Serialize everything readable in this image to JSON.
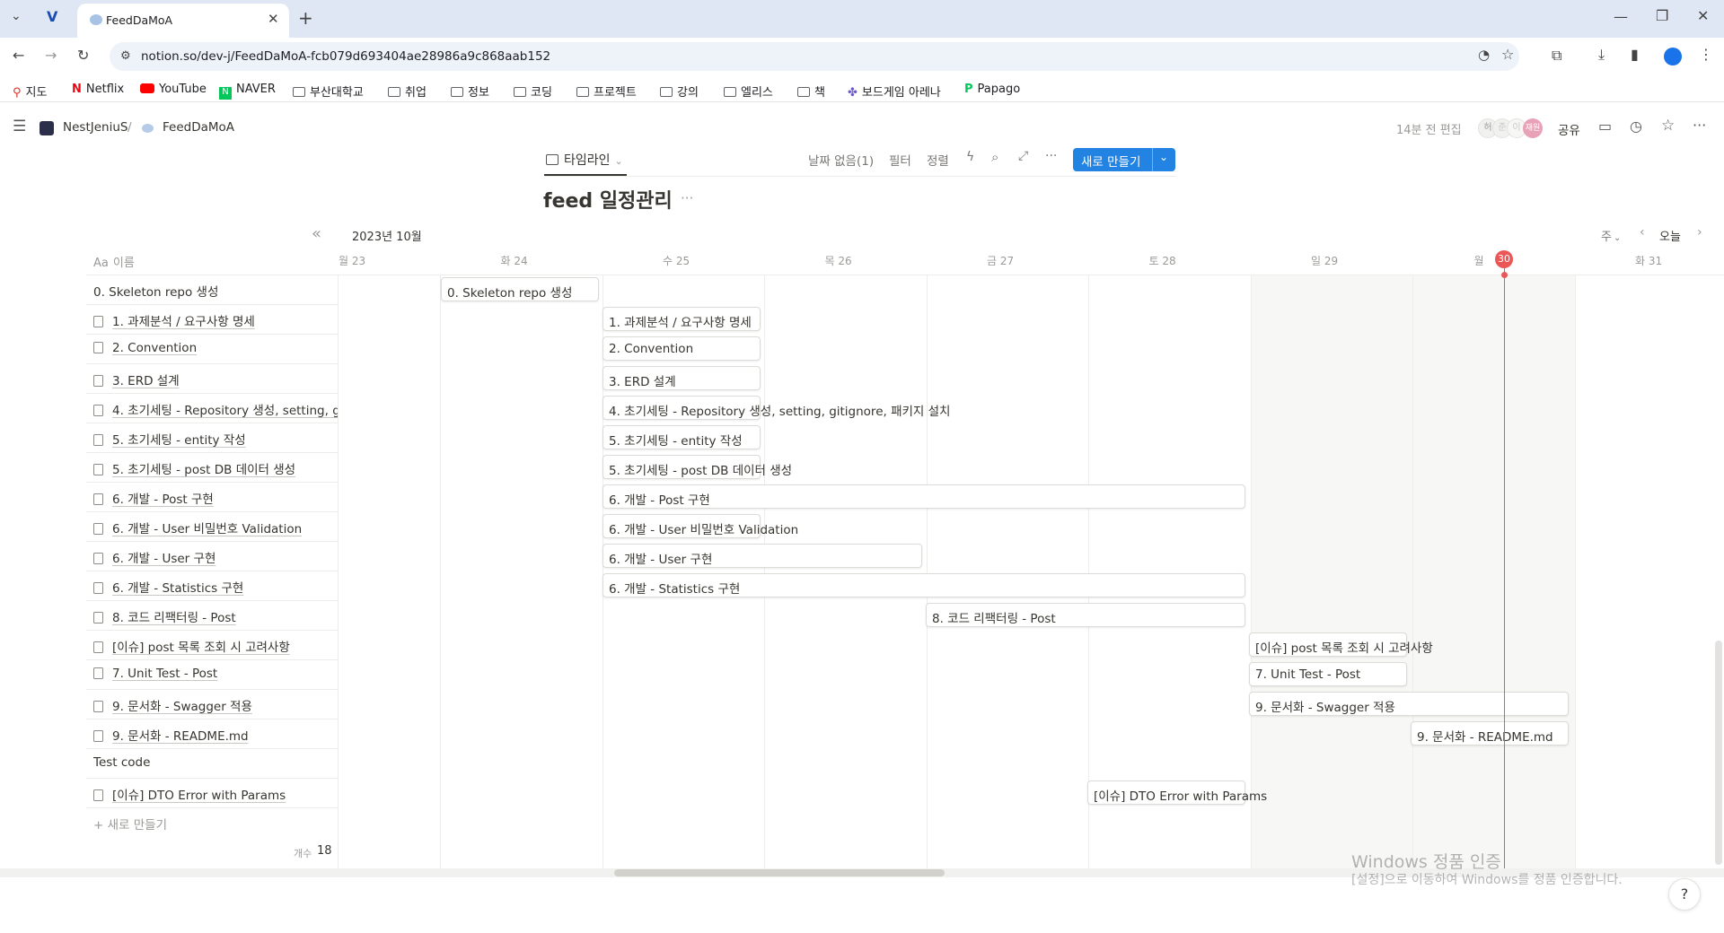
{
  "browser": {
    "tab_title": "FeedDaMoA",
    "url": "notion.so/dev-j/FeedDaMoA-fcb079d693404ae28986a9c868aab152",
    "new_tab": "+",
    "bookmarks": [
      "지도",
      "Netflix",
      "YouTube",
      "NAVER",
      "부산대학교",
      "취업",
      "정보",
      "코딩",
      "프로젝트",
      "강의",
      "엘리스",
      "책",
      "보드게임 아레나",
      "Papago"
    ]
  },
  "topbar": {
    "workspace": "NestJeniuS",
    "separator": "/",
    "page": "FeedDaMoA",
    "edited": "14분 전 편집",
    "share": "공유",
    "avatars": [
      "허",
      "준",
      "이",
      "재원"
    ]
  },
  "view": {
    "name": "타임라인",
    "no_date": "날짜 없음(1)",
    "filter": "필터",
    "sort": "정렬",
    "new_button": "새로 만들기",
    "title": "feed 일정관리",
    "more": "···"
  },
  "timeline": {
    "month": "2023년 10월",
    "name_header": "이름",
    "name_header_prefix": "Aa",
    "scale": "주",
    "today": "오늘",
    "today_day": "30",
    "days": [
      {
        "dow": "월",
        "day": "23"
      },
      {
        "dow": "화",
        "day": "24"
      },
      {
        "dow": "수",
        "day": "25"
      },
      {
        "dow": "목",
        "day": "26"
      },
      {
        "dow": "금",
        "day": "27"
      },
      {
        "dow": "토",
        "day": "28"
      },
      {
        "dow": "일",
        "day": "29"
      },
      {
        "dow": "월",
        "day": ""
      },
      {
        "dow": "화",
        "day": "31"
      }
    ],
    "rows": [
      {
        "name": "0. Skeleton repo 생성",
        "doc": false,
        "bar": "0. Skeleton repo 생성"
      },
      {
        "name": "1. 과제분석 / 요구사항 명세",
        "doc": true,
        "bar": "1. 과제분석 / 요구사항 명세"
      },
      {
        "name": "2. Convention",
        "doc": true,
        "bar": "2. Convention"
      },
      {
        "name": "3. ERD 설계",
        "doc": true,
        "bar": "3. ERD 설계"
      },
      {
        "name": "4. 초기세팅 - Repository 생성, setting, g",
        "doc": true,
        "bar": "4. 초기세팅 - Repository 생성, setting, gitignore, 패키지 설치"
      },
      {
        "name": "5. 초기세팅 - entity 작성",
        "doc": true,
        "bar": "5. 초기세팅 - entity 작성"
      },
      {
        "name": "5. 초기세팅 - post DB 데이터 생성",
        "doc": true,
        "bar": "5. 초기세팅 - post DB 데이터 생성"
      },
      {
        "name": "6. 개발 - Post 구현",
        "doc": true,
        "bar": "6. 개발 - Post 구현"
      },
      {
        "name": "6. 개발 - User 비밀번호 Validation",
        "doc": true,
        "bar": "6. 개발 - User 비밀번호 Validation"
      },
      {
        "name": "6. 개발 - User 구현",
        "doc": true,
        "bar": "6. 개발 - User 구현"
      },
      {
        "name": "6. 개발 - Statistics 구현",
        "doc": true,
        "bar": "6. 개발 - Statistics 구현"
      },
      {
        "name": "8. 코드 리팩터링 - Post",
        "doc": true,
        "bar": "8. 코드 리팩터링 - Post"
      },
      {
        "name": "[이슈] post 목록 조회 시 고려사항",
        "doc": true,
        "bar": "[이슈] post 목록 조회 시 고려사항"
      },
      {
        "name": "7. Unit Test - Post",
        "doc": true,
        "bar": "7. Unit Test - Post"
      },
      {
        "name": "9. 문서화 - Swagger 적용",
        "doc": true,
        "bar": "9. 문서화 - Swagger 적용"
      },
      {
        "name": "9. 문서화 - README.md",
        "doc": true,
        "bar": "9. 문서화 - README.md"
      },
      {
        "name": "Test code",
        "doc": false,
        "bar": ""
      },
      {
        "name": "[이슈] DTO Error with Params",
        "doc": true,
        "bar": "[이슈] DTO Error with Params"
      }
    ],
    "add_new": "+ 새로 만들기",
    "count_label": "개수",
    "count": "18"
  },
  "windows_notice": {
    "title": "Windows 정품 인증",
    "subtitle": "[설정]으로 이동하여 Windows를 정품 인증합니다."
  },
  "help": "?",
  "colors": {
    "accent": "#2383e2",
    "today": "#eb5757",
    "tabbar": "#dfe7f5"
  }
}
